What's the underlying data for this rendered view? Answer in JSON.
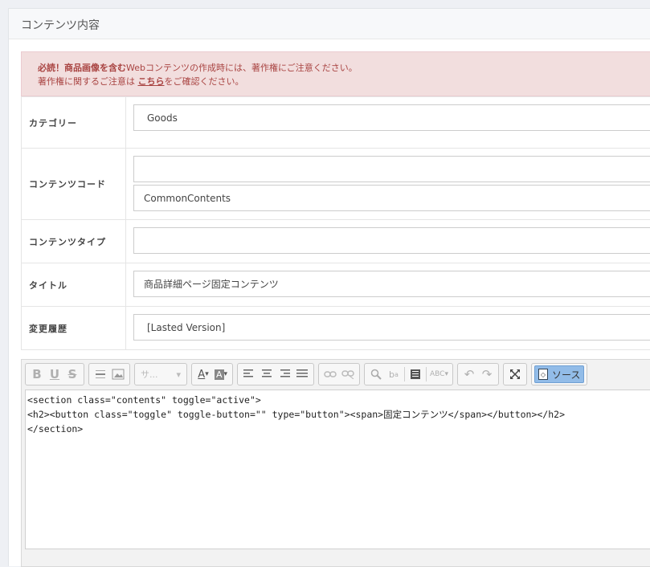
{
  "panel": {
    "title": "コンテンツ内容"
  },
  "alert": {
    "line1_bold": "必読！商品画像を含む",
    "line1_rest": "Webコンテンツの作成時には、著作権にご注意ください。",
    "line2_pre": "著作権に関するご注意は",
    "line2_link": "こちら",
    "line2_post": "をご確認ください。"
  },
  "form": {
    "category": {
      "label": "カテゴリー",
      "value": "Goods"
    },
    "content_code": {
      "label": "コンテンツコード",
      "value1": "",
      "value2": "CommonContents"
    },
    "content_type": {
      "label": "コンテンツタイプ",
      "value": ""
    },
    "title": {
      "label": "タイトル",
      "value": "商品詳細ページ固定コンテンツ"
    },
    "history": {
      "label": "変更履歴",
      "value": "[Lasted Version]"
    }
  },
  "editor": {
    "toolbar": {
      "bold": "B",
      "underline": "U",
      "strike": "S",
      "style_combo": "サ...",
      "font_color": "A",
      "bg_color": "A",
      "source_label": "ソース"
    },
    "code_lines": [
      "<section class=\"contents\" toggle=\"active\">",
      "<h2><button class=\"toggle\" toggle-button=\"\" type=\"button\"><span>固定コンテンツ</span></button></h2>",
      "</section>"
    ]
  }
}
